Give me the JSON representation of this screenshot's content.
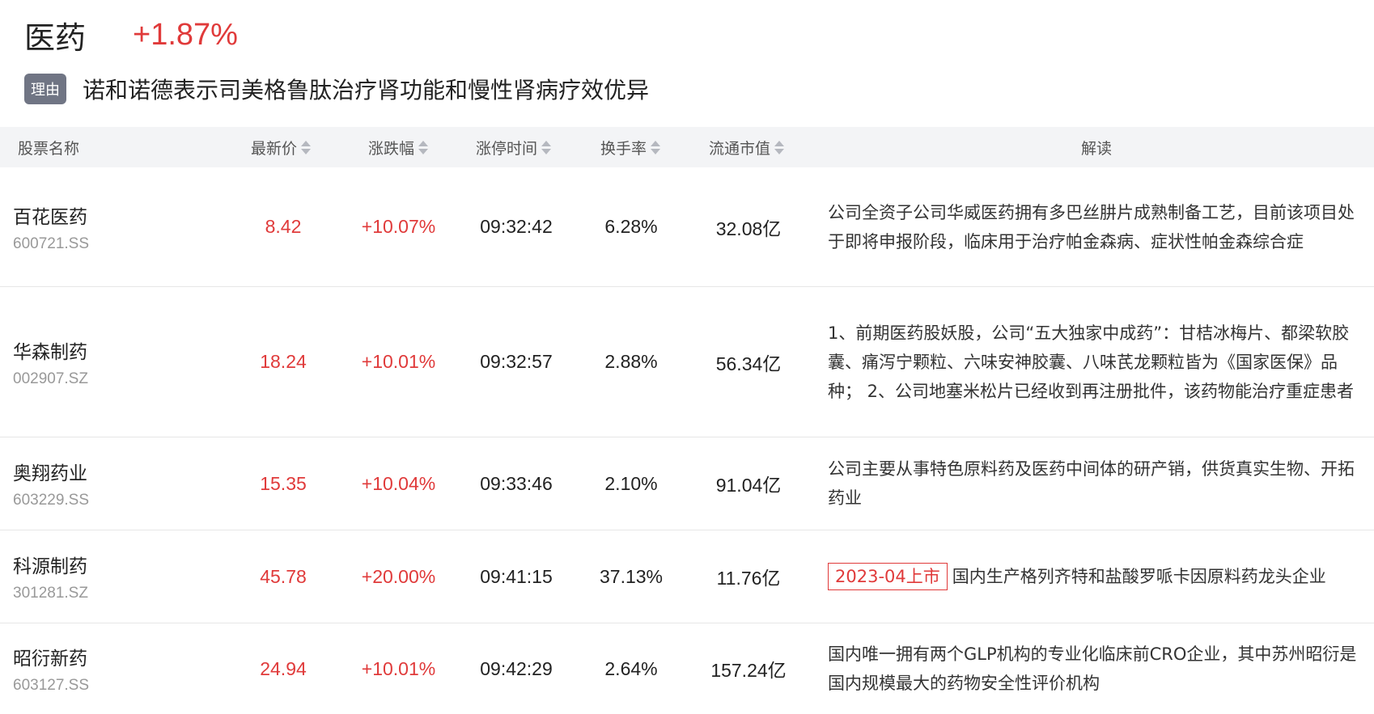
{
  "sector": {
    "name": "医药",
    "change": "+1.87%"
  },
  "reason": {
    "badge": "理由",
    "text": "诺和诺德表示司美格鲁肽治疗肾功能和慢性肾病疗效优异"
  },
  "table": {
    "headers": {
      "name": "股票名称",
      "price": "最新价",
      "change": "涨跌幅",
      "limit_time": "涨停时间",
      "turnover": "换手率",
      "market_cap": "流通市值",
      "interpretation": "解读"
    },
    "rows": [
      {
        "name": "百花医药",
        "code": "600721.SS",
        "price": "8.42",
        "change": "+10.07%",
        "limit_time": "09:32:42",
        "turnover": "6.28%",
        "market_cap": "32.08亿",
        "tag": "",
        "interpretation": "公司全资子公司华威医药拥有多巴丝肼片成熟制备工艺，目前该项目处于即将申报阶段，临床用于治疗帕金森病、症状性帕金森综合症"
      },
      {
        "name": "华森制药",
        "code": "002907.SZ",
        "price": "18.24",
        "change": "+10.01%",
        "limit_time": "09:32:57",
        "turnover": "2.88%",
        "market_cap": "56.34亿",
        "tag": "",
        "interpretation": "1、前期医药股妖股，公司“五大独家中成药”：甘桔冰梅片、都梁软胶囊、痛泻宁颗粒、六味安神胶囊、八味芪龙颗粒皆为《国家医保》品种； 2、公司地塞米松片已经收到再注册批件，该药物能治疗重症患者"
      },
      {
        "name": "奥翔药业",
        "code": "603229.SS",
        "price": "15.35",
        "change": "+10.04%",
        "limit_time": "09:33:46",
        "turnover": "2.10%",
        "market_cap": "91.04亿",
        "tag": "",
        "interpretation": "公司主要从事特色原料药及医药中间体的研产销，供货真实生物、开拓药业"
      },
      {
        "name": "科源制药",
        "code": "301281.SZ",
        "price": "45.78",
        "change": "+20.00%",
        "limit_time": "09:41:15",
        "turnover": "37.13%",
        "market_cap": "11.76亿",
        "tag": "2023-04上市",
        "interpretation": "国内生产格列齐特和盐酸罗哌卡因原料药龙头企业"
      },
      {
        "name": "昭衍新药",
        "code": "603127.SS",
        "price": "24.94",
        "change": "+10.01%",
        "limit_time": "09:42:29",
        "turnover": "2.64%",
        "market_cap": "157.24亿",
        "tag": "",
        "interpretation": "国内唯一拥有两个GLP机构的专业化临床前CRO企业，其中苏州昭衍是国内规模最大的药物安全性评价机构"
      }
    ]
  }
}
